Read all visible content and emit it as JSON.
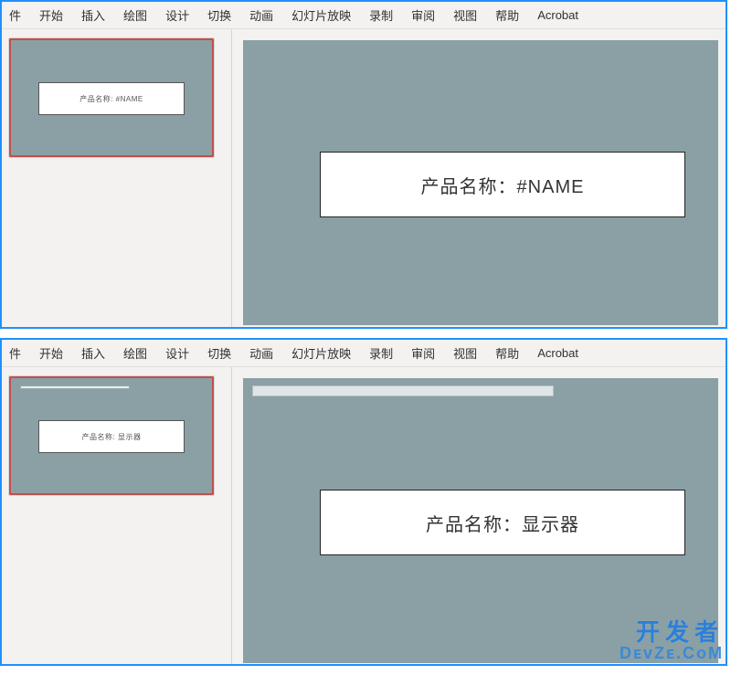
{
  "ribbon_tabs": [
    "件",
    "开始",
    "插入",
    "绘图",
    "设计",
    "切换",
    "动画",
    "幻灯片放映",
    "录制",
    "审阅",
    "视图",
    "帮助",
    "Acrobat"
  ],
  "shots": [
    {
      "show_title_bar_thumb": false,
      "show_title_bar_slide": false,
      "thumb_text": "产品名称: #NAME",
      "slide_text": "产品名称：#NAME"
    },
    {
      "show_title_bar_thumb": true,
      "show_title_bar_slide": true,
      "thumb_text": "产品名称: 显示器",
      "slide_text": "产品名称：显示器"
    }
  ],
  "watermark": {
    "line1": "开发者",
    "line2": "DᴇᴠZᴇ.CᴏM"
  }
}
